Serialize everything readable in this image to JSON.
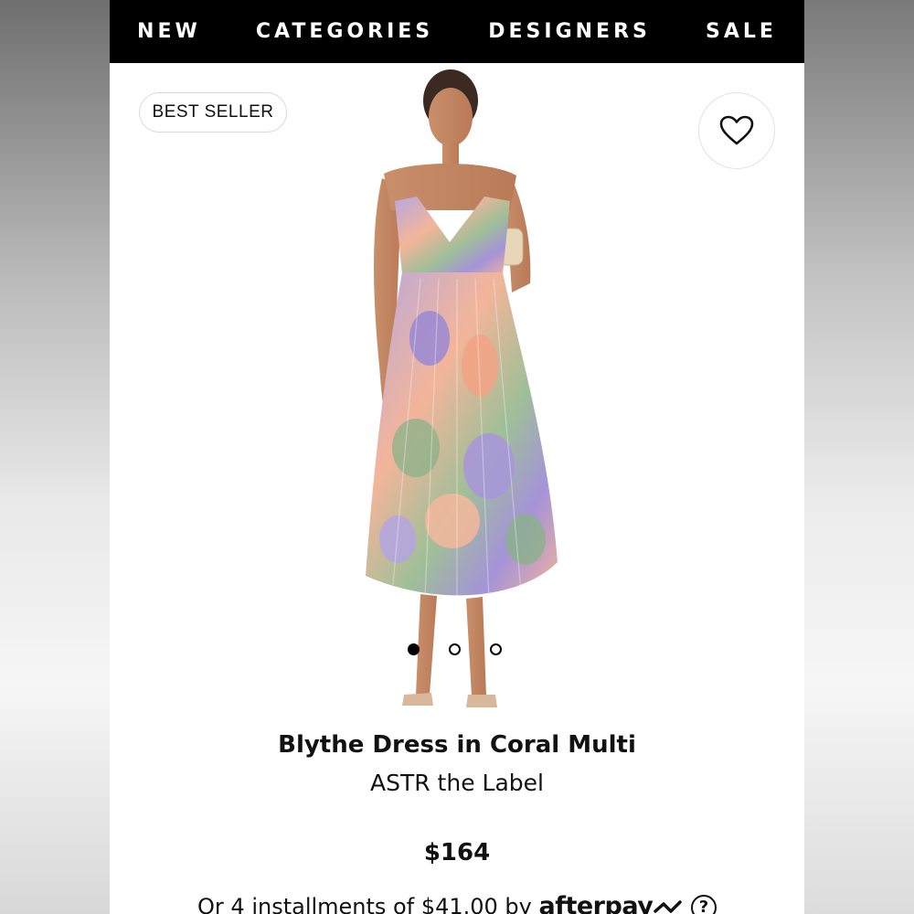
{
  "nav": {
    "items": [
      "NEW",
      "CATEGORIES",
      "DESIGNERS",
      "SALE"
    ]
  },
  "badge": "BEST SELLER",
  "icons": {
    "favorite": "heart-outline-icon",
    "help": "question-circle-icon"
  },
  "carousel": {
    "count": 3,
    "active_index": 0
  },
  "product": {
    "name": "Blythe Dress in Coral Multi",
    "brand": "ASTR the Label",
    "price": "$164",
    "installments_text": "Or 4 installments of $41.00 by",
    "provider": "afterpay",
    "help_glyph": "?"
  },
  "colors": {
    "nav_bg": "#000000",
    "nav_text": "#ffffff",
    "dress_lavender": "#a89ad6",
    "dress_coral": "#f2a98a",
    "dress_green": "#8db08a"
  }
}
